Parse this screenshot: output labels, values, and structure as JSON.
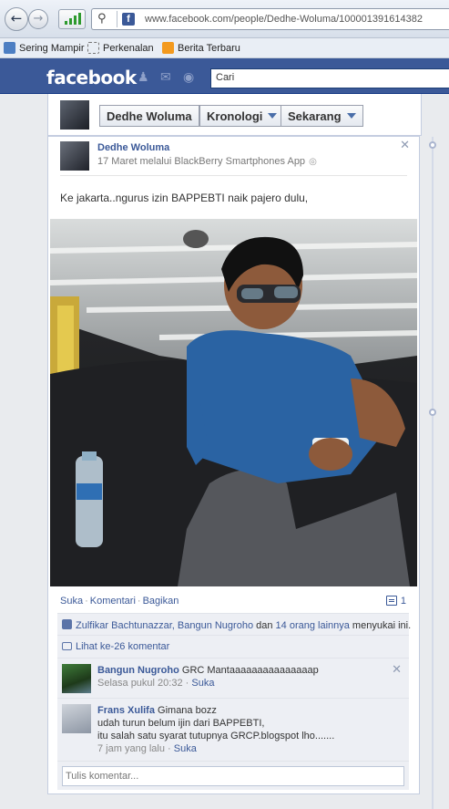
{
  "browser": {
    "back_icon": "arrow-left-icon",
    "forward_icon": "arrow-right-icon",
    "url": "www.facebook.com/people/Dedhe-Woluma/100001391614382",
    "bookmarks": [
      "Sering Mampir",
      "Perkenalan",
      "Berita Terbaru"
    ]
  },
  "facebook": {
    "logo": "facebook",
    "search_placeholder": "Cari",
    "colors": {
      "brand": "#3b5998",
      "link": "#3b5998"
    }
  },
  "profile": {
    "name": "Dedhe Woluma",
    "nav": [
      "Kronologi",
      "Sekarang"
    ]
  },
  "post": {
    "author": "Dedhe Woluma",
    "meta": "17 Maret melalui BlackBerry Smartphones App",
    "text": "Ke jakarta..ngurus izin BAPPEBTI naik pajero dulu,",
    "actions": [
      "Suka",
      "Komentari",
      "Bagikan"
    ],
    "comment_count": "1",
    "likes": {
      "names": "Zulfikar Bachtunazzar, Bangun Nugroho",
      "connector": " dan ",
      "others": "14 orang lainnya",
      "suffix": " menyukai ini."
    },
    "view_comments": "Lihat ke-26 komentar",
    "comments": [
      {
        "author": "Bangun Nugroho",
        "text": "GRC Mantaaaaaaaaaaaaaaap",
        "time": "Selasa pukul 20:32",
        "like": "Suka"
      },
      {
        "author": "Frans Xulifa",
        "line1": "Gimana bozz",
        "line2": "udah turun belum ijin dari BAPPEBTI,",
        "line3": "itu salah satu syarat tutupnya GRCP.blogspot lho.......",
        "time": "7 jam yang lalu",
        "like": "Suka"
      }
    ],
    "comment_placeholder": "Tulis komentar..."
  }
}
